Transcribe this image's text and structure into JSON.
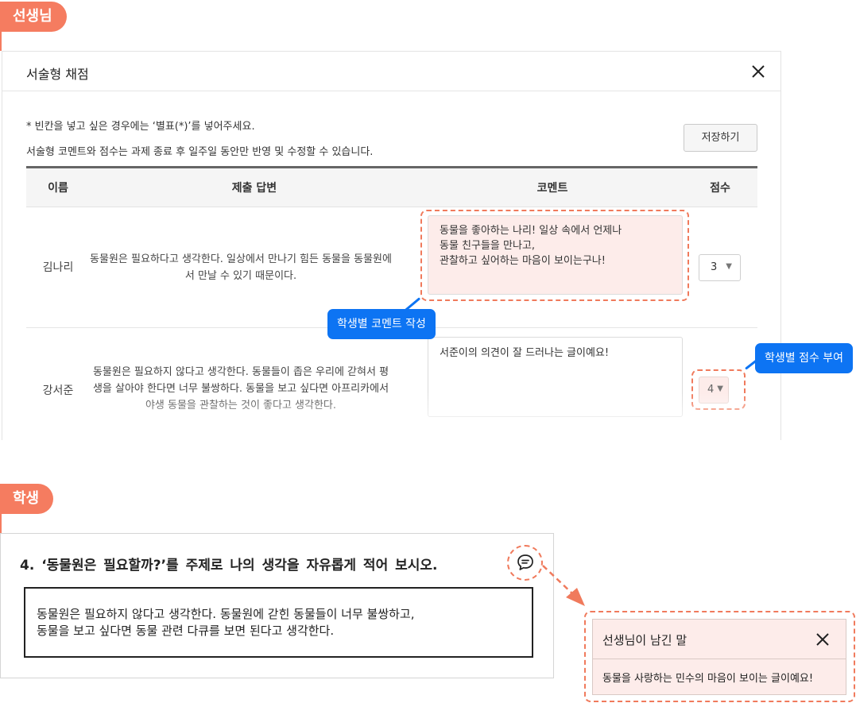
{
  "teacher_badge": "선생님",
  "student_badge": "학생",
  "modal": {
    "title": "서술형 채점",
    "note_1": "* 빈칸을 넣고 싶은 경우에는 ‘별표(*)’를 넣어주세요.",
    "note_2": "서술형 코멘트와 점수는 과제 종료 후 일주일 동안만 반영 및 수정할 수 있습니다.",
    "save_label": "저장하기",
    "columns": [
      "이름",
      "제출 답변",
      "코멘트",
      "점수"
    ],
    "rows": [
      {
        "name": "김나리",
        "answer": "동물원은 필요하다고 생각한다. 일상에서 만나기 힘든 동물을 동물원에서 만날 수 있기 때문이다.",
        "comment": "동물을 좋아하는 나리! 일상 속에서 언제나\n동물 친구들을 만나고,\n관찰하고 싶어하는 마음이 보이는구나!",
        "score": "3"
      },
      {
        "name": "강서준",
        "answer": "동물원은 필요하지 않다고 생각한다. 동물들이 좁은 우리에 갇혀서 평생을 살아야 한다면 너무 불쌍하다. 동물을 보고 싶다면 아프리카에서 야생 동물을 관찰하는 것이 좋다고 생각한다.",
        "comment": "서준이의 의견이 잘 드러나는 글이예요!",
        "score": "4"
      }
    ]
  },
  "callouts": {
    "comment": "학생별 코멘트 작성",
    "score": "학생별 점수 부여"
  },
  "student": {
    "question": "4. ‘동물원은 필요할까?’를 주제로 나의 생각을 자유롭게 적어 보시오.",
    "answer": "동물원은 필요하지 않다고 생각한다. 동물원에 갇힌 동물들이 너무 불쌍하고,\n동물을 보고 싶다면 동물 관련 다큐를 보면 된다고 생각한다."
  },
  "popup": {
    "title": "선생님이 남긴 말",
    "text": "동물을 사랑하는 민수의 마음이 보이는 글이예요!"
  },
  "colors": {
    "accent": "#f57c60",
    "callout": "#0d74f3",
    "highlight_bg": "#fdecea"
  },
  "icons": [
    "close-icon",
    "chat-icon",
    "dropdown-arrow-icon"
  ]
}
